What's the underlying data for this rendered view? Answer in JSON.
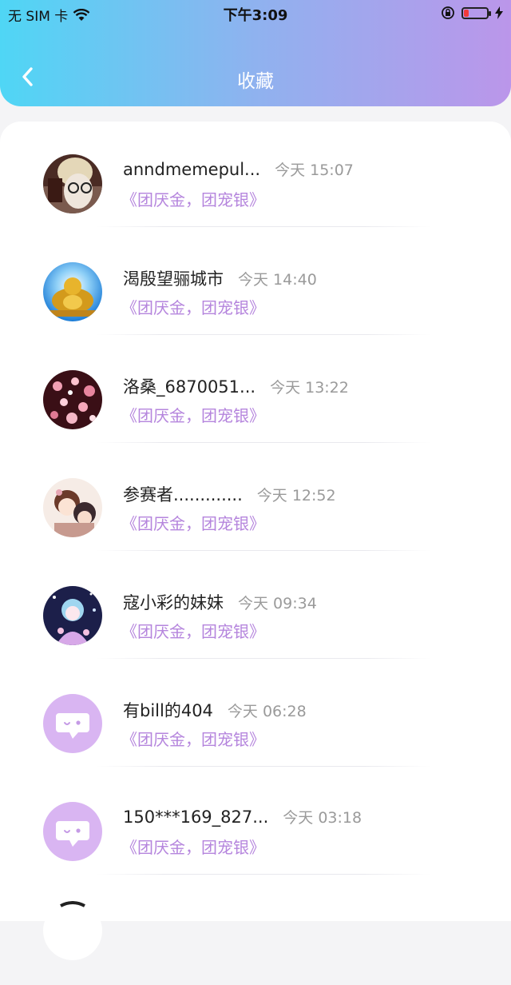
{
  "status": {
    "carrier": "无 SIM 卡",
    "time": "下午3:09"
  },
  "nav": {
    "title": "收藏"
  },
  "items": [
    {
      "name": "anndmemepul...",
      "time": "今天 15:07",
      "subtitle": "《团厌金，团宠银》",
      "avatar": "photo-avatar-1"
    },
    {
      "name": "渴殷望骊城市",
      "time": "今天 14:40",
      "subtitle": "《团厌金，团宠银》",
      "avatar": "buddha-avatar"
    },
    {
      "name": "洛桑_6870051...",
      "time": "今天 13:22",
      "subtitle": "《团厌金，团宠银》",
      "avatar": "blossom-avatar"
    },
    {
      "name": "参赛者.............",
      "time": "今天 12:52",
      "subtitle": "《团厌金，团宠银》",
      "avatar": "anime-avatar-1"
    },
    {
      "name": "寇小彩的妹妹",
      "time": "今天 09:34",
      "subtitle": "《团厌金，团宠银》",
      "avatar": "anime-avatar-2"
    },
    {
      "name": "有bill的404",
      "time": "今天 06:28",
      "subtitle": "《团厌金，团宠银》",
      "avatar": "default-chat-avatar"
    },
    {
      "name": "150***169_827...",
      "time": "今天 03:18",
      "subtitle": "《团厌金，团宠银》",
      "avatar": "default-chat-avatar"
    }
  ],
  "colors": {
    "header_start": "#4fd6f5",
    "header_end": "#bb96ea",
    "subtitle": "#b585dd",
    "default_avatar": "#d9b5f2"
  }
}
